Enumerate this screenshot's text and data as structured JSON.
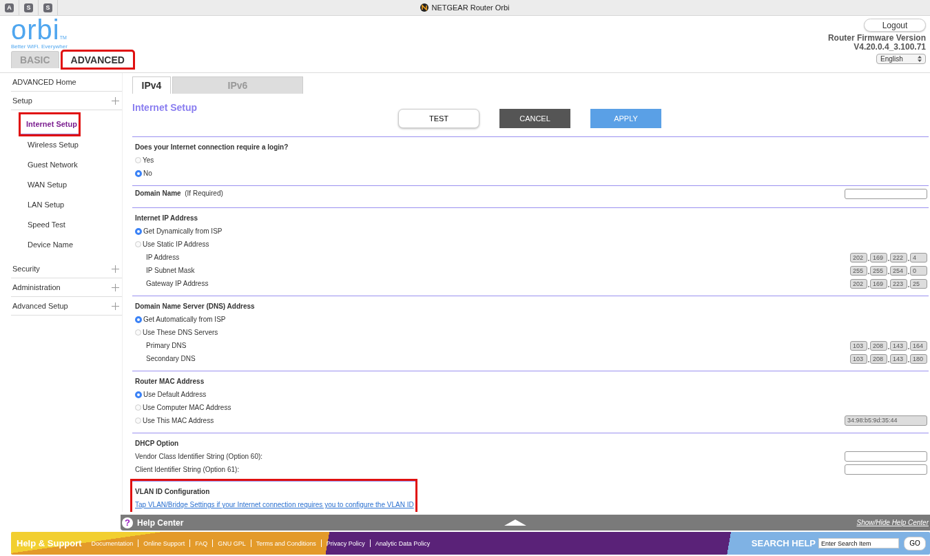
{
  "browser": {
    "title": "NETGEAR Router Orbi",
    "tabs": [
      "A",
      "S",
      "S"
    ]
  },
  "logo": {
    "name": "orbi",
    "trademark": "TM",
    "tagline": "Better WiFi. Everywher"
  },
  "header": {
    "logout": "Logout",
    "firmware_label": "Router Firmware Version",
    "firmware_version": "V4.20.0.4_3.100.71",
    "language": "English"
  },
  "main_tabs": [
    {
      "label": "BASIC",
      "selected": false,
      "highlighted": false
    },
    {
      "label": "ADVANCED",
      "selected": true,
      "highlighted": true
    }
  ],
  "sidebar": {
    "items": [
      {
        "label": "ADVANCED Home",
        "kind": "link"
      },
      {
        "label": "Setup",
        "kind": "group",
        "children": [
          {
            "label": "Internet Setup",
            "selected": true,
            "highlighted": true
          },
          {
            "label": "Wireless Setup",
            "selected": false,
            "highlighted": false
          },
          {
            "label": "Guest Network",
            "selected": false,
            "highlighted": false
          },
          {
            "label": "WAN Setup",
            "selected": false,
            "highlighted": false
          },
          {
            "label": "LAN Setup",
            "selected": false,
            "highlighted": false
          },
          {
            "label": "Speed Test",
            "selected": false,
            "highlighted": false
          },
          {
            "label": "Device Name",
            "selected": false,
            "highlighted": false
          }
        ]
      },
      {
        "label": "Security",
        "kind": "group"
      },
      {
        "label": "Administration",
        "kind": "group"
      },
      {
        "label": "Advanced Setup",
        "kind": "group"
      }
    ]
  },
  "ip_tabs": [
    {
      "label": "IPv4",
      "selected": true
    },
    {
      "label": "IPv6",
      "selected": false
    }
  ],
  "page_title": "Internet Setup",
  "buttons": [
    {
      "label": "TEST",
      "kind": "outline"
    },
    {
      "label": "CANCEL",
      "kind": "dark"
    },
    {
      "label": "APPLY",
      "kind": "primary"
    }
  ],
  "sections": [
    {
      "title": "Does your Internet connection require a login?",
      "highlighted": false,
      "rows": [
        {
          "kind": "radio",
          "label": "Yes",
          "selected": false
        },
        {
          "kind": "radio",
          "label": "No",
          "selected": true
        }
      ]
    },
    {
      "title": "Domain Name",
      "title_note": "(If Required)",
      "kind": "cut",
      "highlighted": false
    },
    {
      "title": "Internet IP Address",
      "highlighted": false,
      "rows": [
        {
          "kind": "radio",
          "label": "Get Dynamically from ISP",
          "selected": true
        },
        {
          "kind": "radio",
          "label": "Use Static IP Address",
          "selected": false
        },
        {
          "kind": "octets",
          "label": "IP Address",
          "values": [
            "202",
            "169",
            "222",
            "4"
          ]
        },
        {
          "kind": "octets",
          "label": "IP Subnet Mask",
          "values": [
            "255",
            "255",
            "254",
            "0"
          ]
        },
        {
          "kind": "octets",
          "label": "Gateway IP Address",
          "values": [
            "202",
            "169",
            "223",
            "25"
          ]
        }
      ]
    },
    {
      "title": "Domain Name Server (DNS) Address",
      "highlighted": false,
      "rows": [
        {
          "kind": "radio",
          "label": "Get Automatically from ISP",
          "selected": true
        },
        {
          "kind": "radio",
          "label": "Use These DNS Servers",
          "selected": false
        },
        {
          "kind": "octets",
          "label": "Primary DNS",
          "values": [
            "103",
            "208",
            "143",
            "164"
          ]
        },
        {
          "kind": "octets",
          "label": "Secondary DNS",
          "values": [
            "103",
            "208",
            "143",
            "180"
          ]
        }
      ]
    },
    {
      "title": "Router MAC Address",
      "highlighted": false,
      "rows": [
        {
          "kind": "radio",
          "label": "Use Default Address",
          "selected": true
        },
        {
          "kind": "radio",
          "label": "Use Computer MAC Address",
          "selected": false
        },
        {
          "kind": "radio_field",
          "label": "Use This MAC Address",
          "selected": false,
          "value": "34:98:b5:9d:35:44"
        }
      ]
    },
    {
      "title": "DHCP Option",
      "highlighted": false,
      "rows": [
        {
          "kind": "input",
          "label": "Vendor Class Identifier String (Option 60):"
        },
        {
          "kind": "input",
          "label": "Client Identifier String (Option 61):"
        }
      ]
    },
    {
      "title": "VLAN ID Configuration",
      "highlighted": true,
      "rows": [
        {
          "kind": "link",
          "label": "Tap VLAN/Bridge Settings if your Internet connection requires you to configure the VLAN ID"
        }
      ]
    }
  ],
  "help_center": {
    "icon": "?",
    "title": "Help Center",
    "toggle": "Show/Hide Help Center"
  },
  "footer": {
    "title": "Help & Support",
    "links": [
      "Documentation",
      "Online Support",
      "FAQ",
      "GNU GPL",
      "Terms and Conditions",
      "Privacy Policy",
      "Analytic Data Policy"
    ],
    "search_label": "SEARCH HELP",
    "search_placeholder": "Enter Search Item",
    "go": "GO"
  }
}
